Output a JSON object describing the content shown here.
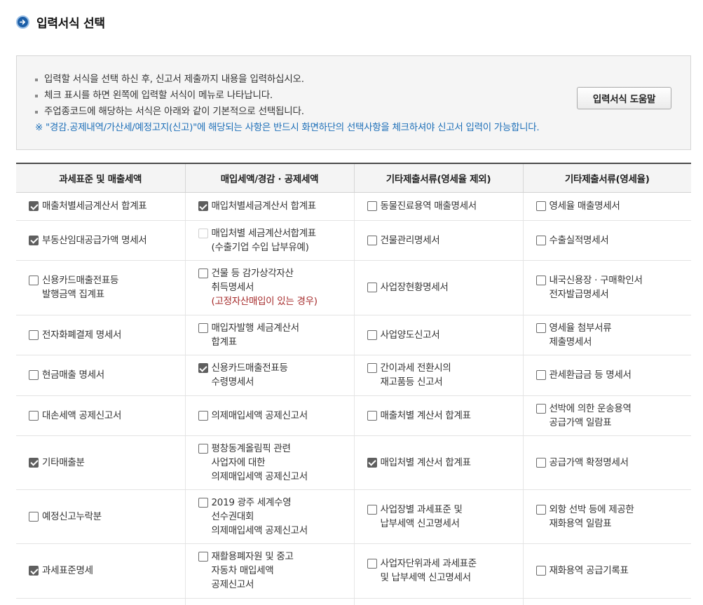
{
  "page": {
    "title": "입력서식 선택",
    "title_icon": "arrow-right-circle-icon",
    "accent_color": "#1c5fa8"
  },
  "info": {
    "lines": [
      "입력할 서식을 선택 하신 후, 신고서 제출까지 내용을 입력하십시오.",
      "체크 표시를 하면 왼쪽에 입력할 서식이 메뉴로 나타납니다.",
      "주업종코드에 해당하는 서식은 아래와 같이 기본적으로 선택됩니다."
    ],
    "note": "※ \"경감.공제내역/가산세/예정고지(신고)\"에 해당되는 사항은 반드시 화면하단의 선택사항을 체크하셔야 신고서 입력이 가능합니다.",
    "note_color": "#1d6fb8",
    "help_button_label": "입력서식 도움말"
  },
  "table": {
    "headers": [
      "과세표준 및 매출세액",
      "매입세액/경감 · 공제세액",
      "기타제출서류(영세율 제외)",
      "기타제출서류(영세율)"
    ],
    "rows": [
      [
        {
          "lines": [
            "매출처별세금계산서 합계표"
          ],
          "checked": true
        },
        {
          "lines": [
            "매입처별세금계산서 합계표"
          ],
          "checked": true
        },
        {
          "lines": [
            "동물진료용역 매출명세서"
          ],
          "checked": false
        },
        {
          "lines": [
            "영세율 매출명세서"
          ],
          "checked": false
        }
      ],
      [
        {
          "lines": [
            "부동산임대공급가액 명세서"
          ],
          "checked": true
        },
        {
          "lines": [
            "매입처별 세금계산서합계표",
            "(수출기업 수입 납부유예)"
          ],
          "checked": false,
          "disabled": true
        },
        {
          "lines": [
            "건물관리명세서"
          ],
          "checked": false
        },
        {
          "lines": [
            "수출실적명세서"
          ],
          "checked": false
        }
      ],
      [
        {
          "lines": [
            "신용카드매출전표등",
            "발행금액 집계표"
          ],
          "checked": false
        },
        {
          "lines": [
            "건물 등 감가상각자산",
            "취득명세서",
            "(고정자산매입이 있는 경우)"
          ],
          "checked": false,
          "red_line": 2
        },
        {
          "lines": [
            "사업장현황명세서"
          ],
          "checked": false
        },
        {
          "lines": [
            "내국신용장 · 구매확인서",
            "전자발급명세서"
          ],
          "checked": false
        }
      ],
      [
        {
          "lines": [
            "전자화폐결제 명세서"
          ],
          "checked": false
        },
        {
          "lines": [
            "매입자발행 세금계산서",
            "합계표"
          ],
          "checked": false
        },
        {
          "lines": [
            "사업양도신고서"
          ],
          "checked": false
        },
        {
          "lines": [
            "영세율 첨부서류",
            "제출명세서"
          ],
          "checked": false
        }
      ],
      [
        {
          "lines": [
            "현금매출 명세서"
          ],
          "checked": false
        },
        {
          "lines": [
            "신용카드매출전표등",
            "수령명세서"
          ],
          "checked": true
        },
        {
          "lines": [
            "간이과세 전환시의",
            "재고품등 신고서"
          ],
          "checked": false
        },
        {
          "lines": [
            "관세환급금 등 명세서"
          ],
          "checked": false
        }
      ],
      [
        {
          "lines": [
            "대손세액 공제신고서"
          ],
          "checked": false
        },
        {
          "lines": [
            "의제매입세액 공제신고서"
          ],
          "checked": false
        },
        {
          "lines": [
            "매출처별 계산서 합계표"
          ],
          "checked": false
        },
        {
          "lines": [
            "선박에 의한 운송용역",
            "공급가액 일람표"
          ],
          "checked": false
        }
      ],
      [
        {
          "lines": [
            "기타매출분"
          ],
          "checked": true
        },
        {
          "lines": [
            "평창동계올림픽 관련",
            "사업자에 대한",
            "의제매입세액 공제신고서"
          ],
          "checked": false
        },
        {
          "lines": [
            "매입처별 계산서 합계표"
          ],
          "checked": true
        },
        {
          "lines": [
            "공급가액 확정명세서"
          ],
          "checked": false
        }
      ],
      [
        {
          "lines": [
            "예정신고누락분"
          ],
          "checked": false
        },
        {
          "lines": [
            "2019 광주 세계수영",
            "선수권대회",
            "의제매입세액 공제신고서"
          ],
          "checked": false
        },
        {
          "lines": [
            "사업장별 과세표준 및",
            "납부세액 신고명세서"
          ],
          "checked": false
        },
        {
          "lines": [
            "외항 선박 등에 제공한",
            "재화용역 일람표"
          ],
          "checked": false
        }
      ],
      [
        {
          "lines": [
            "과세표준명세"
          ],
          "checked": true
        },
        {
          "lines": [
            "재활용폐자원 및 중고",
            "자동차 매입세액",
            "공제신고서"
          ],
          "checked": false
        },
        {
          "lines": [
            "사업자단위과세 과세표준",
            "및 납부세액 신고명세서"
          ],
          "checked": false
        },
        {
          "lines": [
            "재화용역 공급기록표"
          ],
          "checked": false
        }
      ],
      [
        {
          "lines": [
            ""
          ],
          "checked": false,
          "hidden": true
        },
        {
          "lines": [
            ""
          ],
          "checked": false,
          "hidden": true
        },
        {
          "lines": [
            ""
          ],
          "checked": false,
          "hidden": true
        },
        {
          "lines": [
            ""
          ],
          "checked": false,
          "hidden": true
        }
      ]
    ]
  }
}
